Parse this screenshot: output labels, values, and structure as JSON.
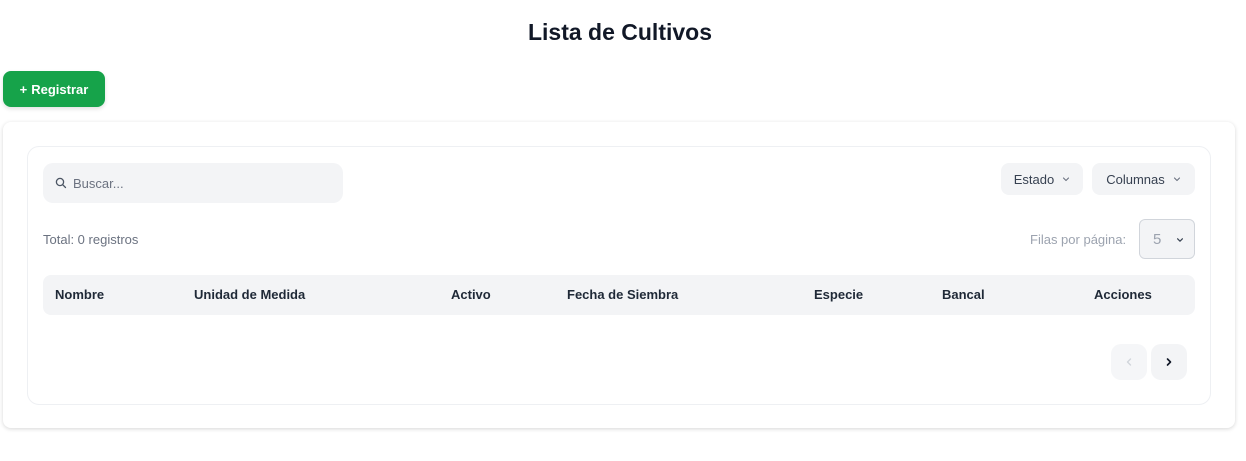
{
  "page": {
    "title": "Lista de Cultivos"
  },
  "toolbar": {
    "register_label": "Registrar",
    "register_prefix": "+"
  },
  "search": {
    "placeholder": "Buscar..."
  },
  "filters": {
    "estado_label": "Estado",
    "columnas_label": "Columnas"
  },
  "summary": {
    "total_text": "Total: 0 registros"
  },
  "pagination": {
    "rows_label": "Filas por página:",
    "rows_value": "5"
  },
  "table": {
    "columns": [
      "Nombre",
      "Unidad de Medida",
      "Activo",
      "Fecha de Siembra",
      "Especie",
      "Bancal",
      "Acciones"
    ]
  },
  "colors": {
    "primary": "#16a34a",
    "header_bg": "#f3f4f6"
  },
  "icons": {
    "search": "search-icon",
    "chevron": "chevron-down-icon",
    "prev": "chevron-left-icon",
    "next": "chevron-right-icon"
  }
}
